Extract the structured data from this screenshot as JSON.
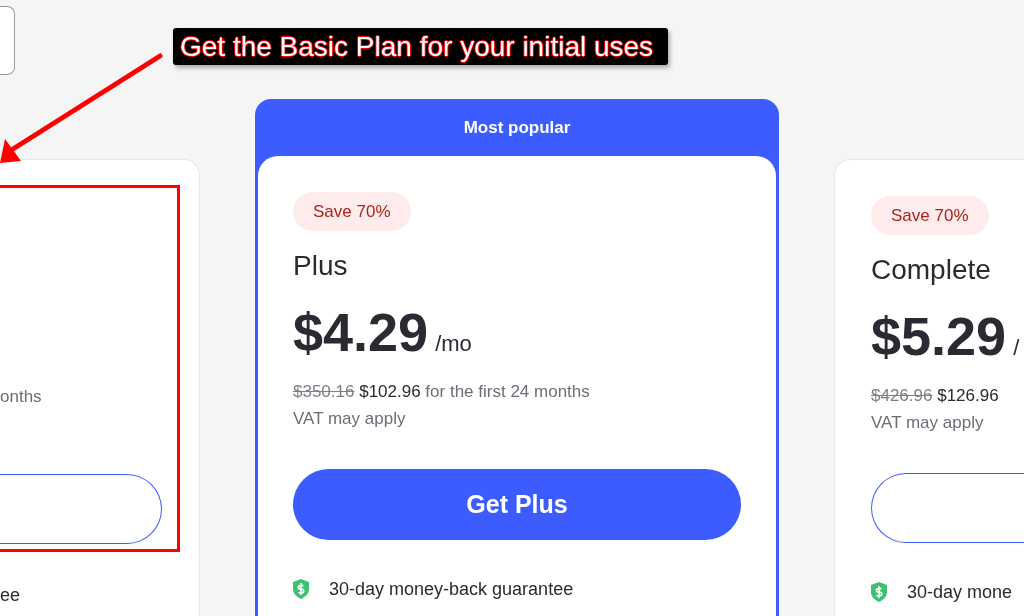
{
  "callout": {
    "text": "Get the Basic Plan for your initial uses"
  },
  "plans": [
    {
      "kind": "fragment",
      "featured": false,
      "billing": "onths",
      "guarantee": "ee"
    },
    {
      "kind": "full",
      "featured": true,
      "ribbon": "Most popular",
      "badge": "Save 70%",
      "name": "Plus",
      "price": "$4.29",
      "period": "/mo",
      "old_total": "$350.16",
      "new_total": "$102.96",
      "billing": "for the first 24 months",
      "vat": "VAT may apply",
      "button": "Get Plus",
      "guarantee": "30-day money-back guarantee"
    },
    {
      "kind": "full",
      "featured": false,
      "badge": "Save 70%",
      "name": "Complete",
      "price": "$5.29",
      "period": "/",
      "old_total": "$426.96",
      "new_total": "$126.96",
      "vat": "VAT may apply",
      "guarantee": "30-day mone"
    }
  ]
}
